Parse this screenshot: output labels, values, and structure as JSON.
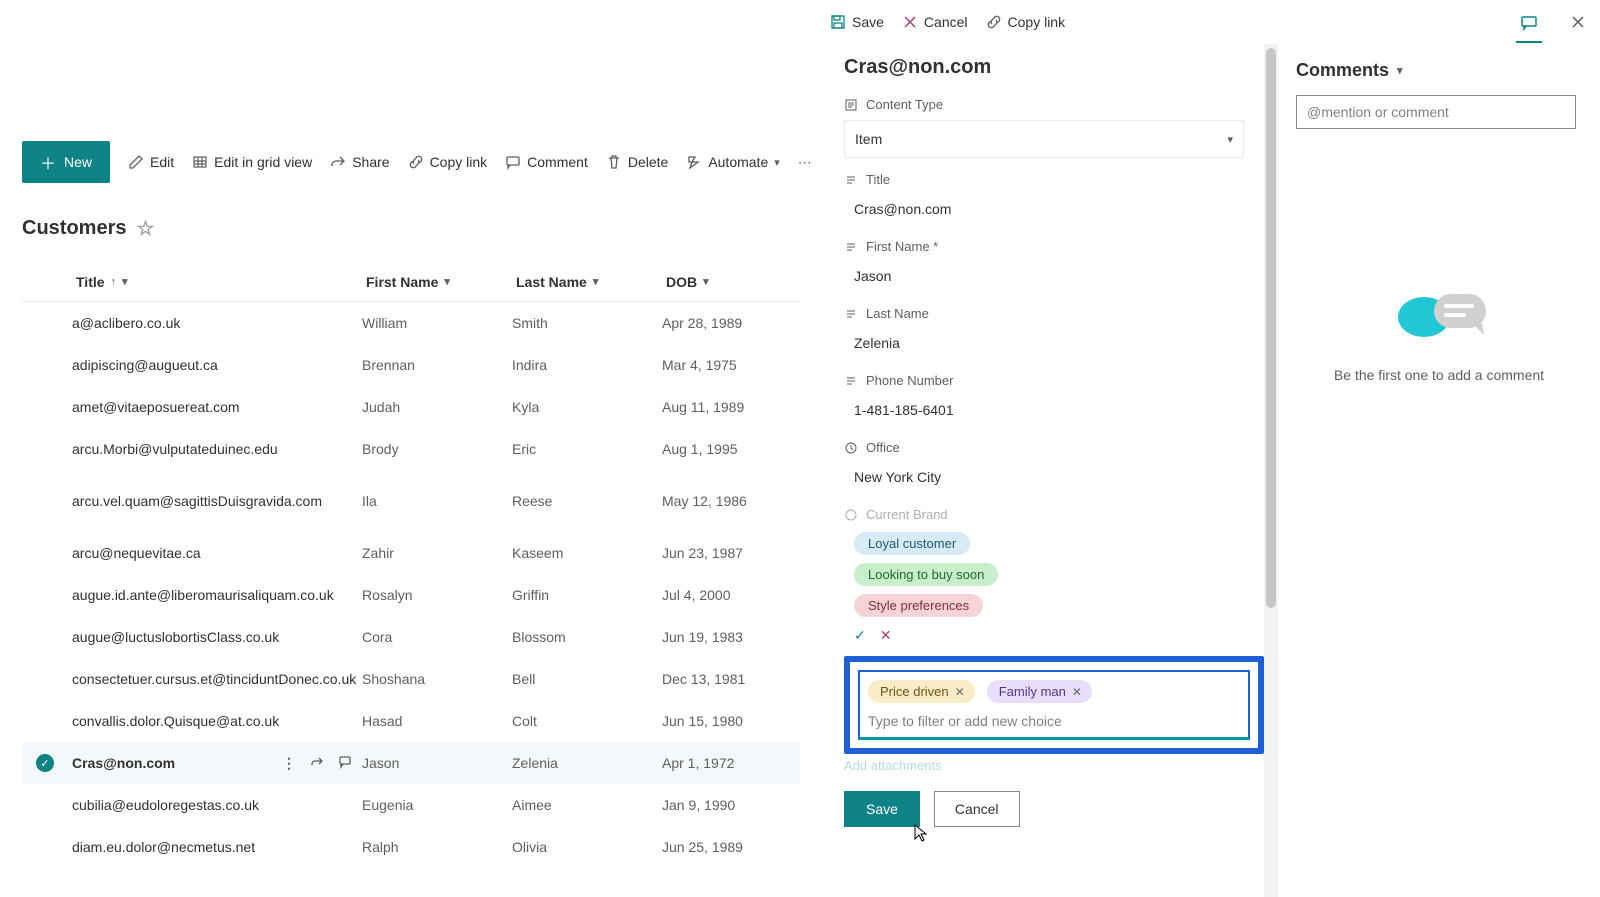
{
  "top_commands": {
    "save": "Save",
    "cancel": "Cancel",
    "copylink": "Copy link"
  },
  "toolbar": {
    "new": "New",
    "edit": "Edit",
    "edit_grid": "Edit in grid view",
    "share": "Share",
    "copylink": "Copy link",
    "comment": "Comment",
    "delete": "Delete",
    "automate": "Automate"
  },
  "list": {
    "name": "Customers"
  },
  "columns": {
    "title": "Title",
    "first": "First Name",
    "last": "Last Name",
    "dob": "DOB"
  },
  "rows": [
    {
      "title": "a@aclibero.co.uk",
      "first": "William",
      "last": "Smith",
      "dob": "Apr 28, 1989"
    },
    {
      "title": "adipiscing@augueut.ca",
      "first": "Brennan",
      "last": "Indira",
      "dob": "Mar 4, 1975"
    },
    {
      "title": "amet@vitaeposuereat.com",
      "first": "Judah",
      "last": "Kyla",
      "dob": "Aug 11, 1989"
    },
    {
      "title": "arcu.Morbi@vulputateduinec.edu",
      "first": "Brody",
      "last": "Eric",
      "dob": "Aug 1, 1995"
    },
    {
      "title": "arcu.vel.quam@sagittisDuisgravida.com",
      "first": "Ila",
      "last": "Reese",
      "dob": "May 12, 1986"
    },
    {
      "title": "arcu@nequevitae.ca",
      "first": "Zahir",
      "last": "Kaseem",
      "dob": "Jun 23, 1987"
    },
    {
      "title": "augue.id.ante@liberomaurisaliquam.co.uk",
      "first": "Rosalyn",
      "last": "Griffin",
      "dob": "Jul 4, 2000"
    },
    {
      "title": "augue@luctuslobortisClass.co.uk",
      "first": "Cora",
      "last": "Blossom",
      "dob": "Jun 19, 1983"
    },
    {
      "title": "consectetuer.cursus.et@tinciduntDonec.co.uk",
      "first": "Shoshana",
      "last": "Bell",
      "dob": "Dec 13, 1981"
    },
    {
      "title": "convallis.dolor.Quisque@at.co.uk",
      "first": "Hasad",
      "last": "Colt",
      "dob": "Jun 15, 1980"
    },
    {
      "title": "Cras@non.com",
      "first": "Jason",
      "last": "Zelenia",
      "dob": "Apr 1, 1972"
    },
    {
      "title": "cubilia@eudoloregestas.co.uk",
      "first": "Eugenia",
      "last": "Aimee",
      "dob": "Jan 9, 1990"
    },
    {
      "title": "diam.eu.dolor@necmetus.net",
      "first": "Ralph",
      "last": "Olivia",
      "dob": "Jun 25, 1989"
    }
  ],
  "selected_index": 10,
  "form": {
    "heading": "Cras@non.com",
    "content_type_label": "Content Type",
    "content_type_value": "Item",
    "title_label": "Title",
    "title_value": "Cras@non.com",
    "first_label": "First Name *",
    "first_value": "Jason",
    "last_label": "Last Name",
    "last_value": "Zelenia",
    "phone_label": "Phone Number",
    "phone_value": "1-481-185-6401",
    "office_label": "Office",
    "office_value": "New York City",
    "current_brand_label": "Current Brand",
    "tag_options": {
      "loyal": "Loyal customer",
      "looking": "Looking to buy soon",
      "style": "Style preferences"
    },
    "selected_chips": {
      "price": "Price driven",
      "family": "Family man"
    },
    "filter_placeholder": "Type to filter or add new choice",
    "add_attachments": "Add attachments",
    "save": "Save",
    "cancel": "Cancel"
  },
  "comments": {
    "heading": "Comments",
    "mention_placeholder": "@mention or comment",
    "empty": "Be the first one to add a comment"
  }
}
